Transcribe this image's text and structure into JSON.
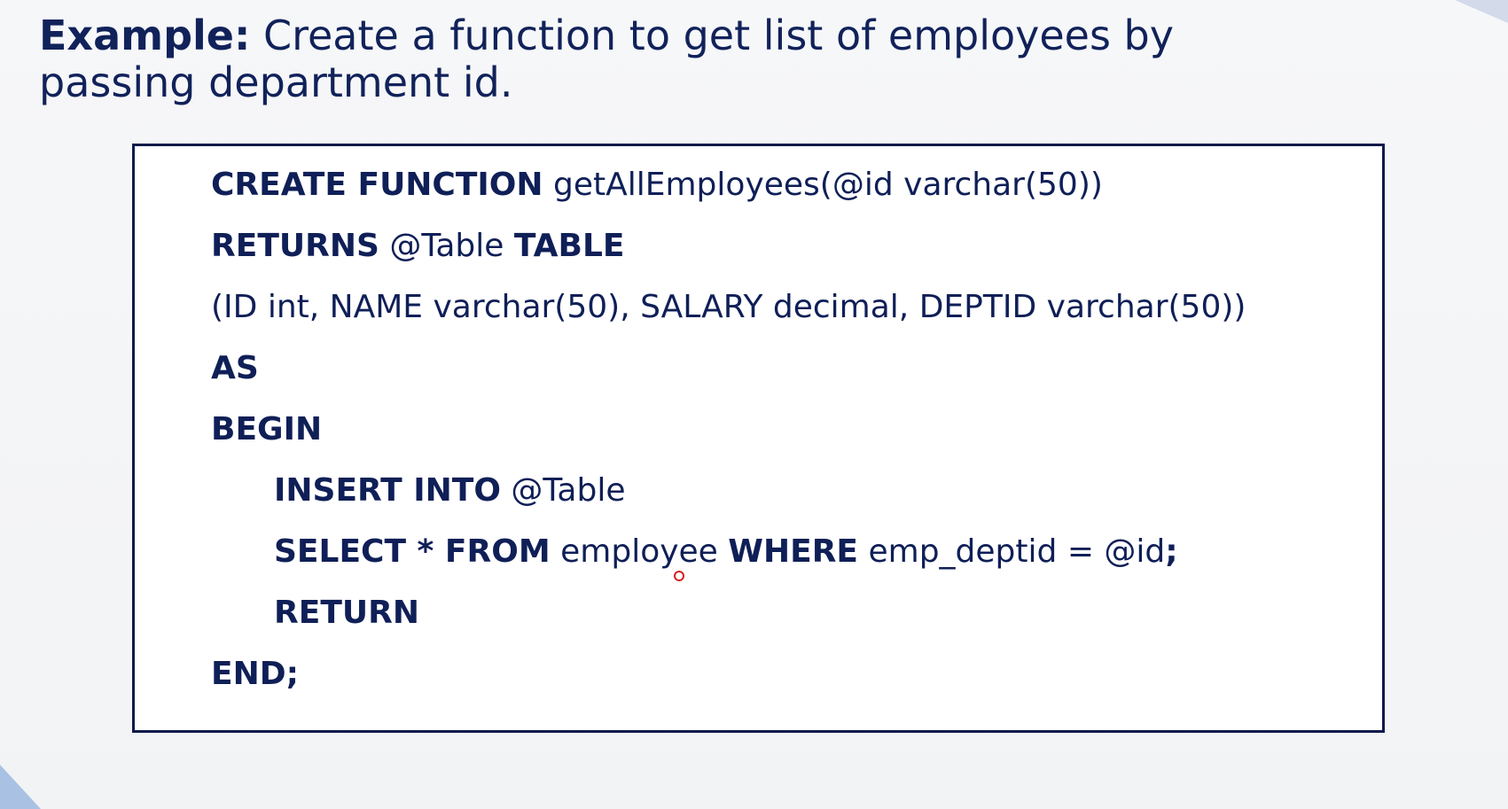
{
  "heading": {
    "label": "Example:",
    "text": "Create a function to get list of employees by passing department id."
  },
  "code": {
    "line1": {
      "kw1": "CREATE FUNCTION",
      "rest": "getAllEmployees(@id varchar(50))"
    },
    "line2": {
      "kw1": "RETURNS",
      "mid": "@Table",
      "kw2": "TABLE"
    },
    "line3": {
      "rest": "(ID int, NAME varchar(50), SALARY decimal, DEPTID varchar(50))"
    },
    "line4": {
      "kw1": "AS"
    },
    "line5": {
      "kw1": "BEGIN"
    },
    "line6": {
      "kw1": "INSERT INTO",
      "rest": "@Table"
    },
    "line7": {
      "kw1": "SELECT * FROM",
      "mid": "employee",
      "kw2": "WHERE",
      "rest": "emp_deptid = @id",
      "end": ";"
    },
    "line8": {
      "kw1": "RETURN"
    },
    "line9": {
      "kw1": "END;"
    }
  },
  "colors": {
    "text": "#11225a",
    "border": "#0d1a4a",
    "accent": "#a9c1e3",
    "cursor": "#d42020"
  }
}
